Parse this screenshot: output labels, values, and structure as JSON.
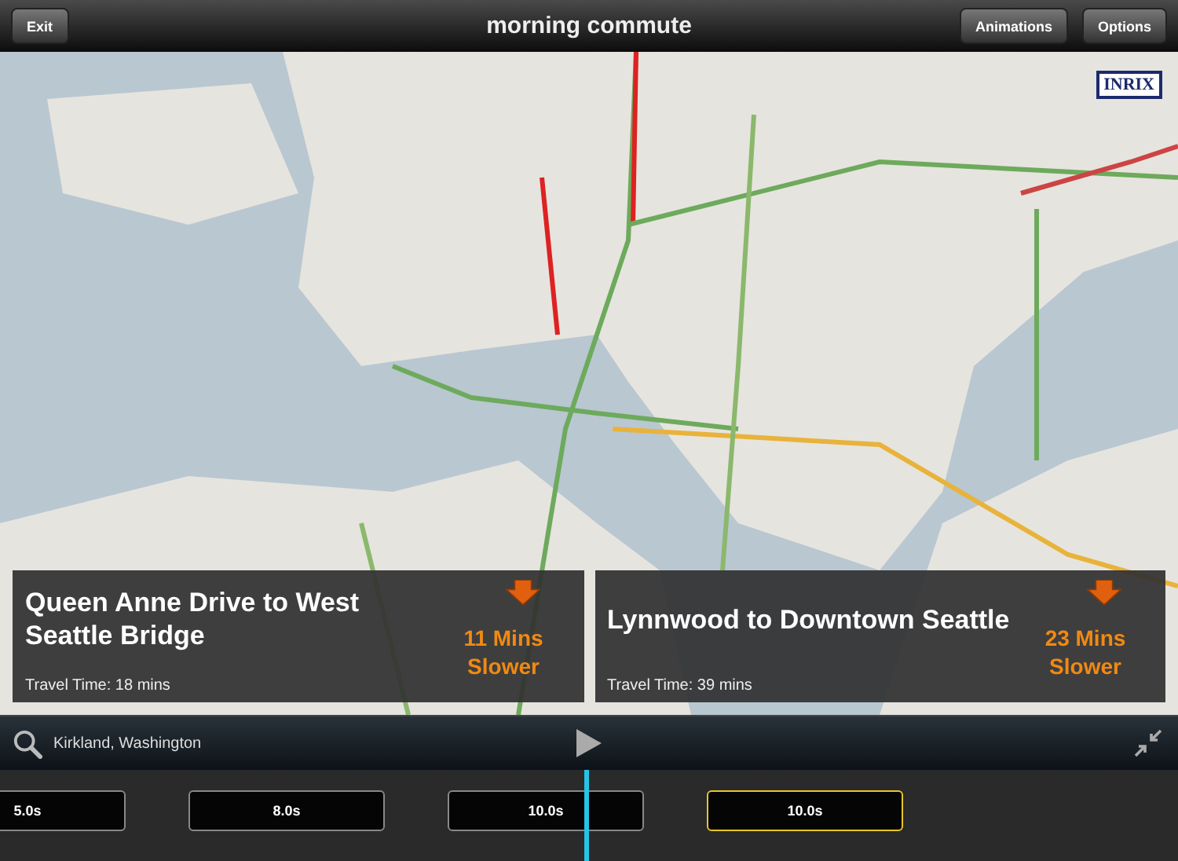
{
  "toolbar": {
    "exit_button": "Exit",
    "title": "morning commute",
    "buttons": [
      "Animations",
      "Options"
    ]
  },
  "map": {
    "logo": "INRIX"
  },
  "routes": [
    {
      "name": "Queen Anne Drive to West Seattle Bridge",
      "delay": "11 Mins Slower",
      "travel_time": "Travel Time: 18 mins"
    },
    {
      "name": "Lynnwood to Downtown Seattle",
      "delay": "23 Mins Slower",
      "travel_time": "Travel Time: 39 mins"
    }
  ],
  "search": {
    "value": "Kirkland, Washington"
  },
  "timeline": {
    "clips": [
      {
        "label": "5.0s",
        "selected": false
      },
      {
        "label": "8.0s",
        "selected": false
      },
      {
        "label": "10.0s",
        "selected": false
      },
      {
        "label": "10.0s",
        "selected": true
      }
    ]
  }
}
